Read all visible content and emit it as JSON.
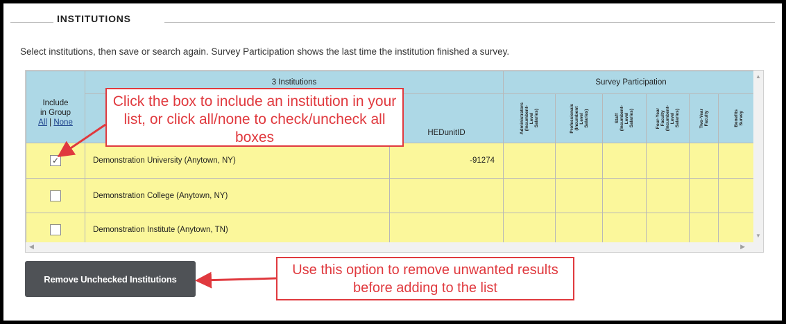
{
  "section": {
    "title": "INSTITUTIONS",
    "intro": "Select institutions, then save or search again. Survey Participation shows the last time the institution finished a survey."
  },
  "table": {
    "group_header": "3 Institutions",
    "survey_header": "Survey Participation",
    "include_label_line1": "Include",
    "include_label_line2": "in Group",
    "all_link": "All",
    "separator": "|",
    "none_link": "None",
    "hed_header": "HEDunitID",
    "survey_columns": [
      "Administrators\n(Incumbent-\nLevel\nSalaries)",
      "Professionals\n(Incumbent\nLevel\nSalaries)",
      "Staff\n(Incumbent-\nLevel\nSalaries)",
      "Four-Year\nFaculty\n(Incumbent-\nLevel\nSalaries)",
      "Two-Year\nFaculty",
      "Benefits\nSurvey"
    ],
    "rows": [
      {
        "checked": true,
        "check_mark": "✓",
        "name": "Demonstration University (Anytown, NY)",
        "hedunitid": "-91274"
      },
      {
        "checked": false,
        "check_mark": "",
        "name": "Demonstration College (Anytown, NY)",
        "hedunitid": ""
      },
      {
        "checked": false,
        "check_mark": "",
        "name": "Demonstration Institute (Anytown, TN)",
        "hedunitid": ""
      }
    ]
  },
  "button": {
    "label": "Remove Unchecked Institutions"
  },
  "callouts": {
    "include_tip": "Click the box to include an institution in your list, or click all/none to check/uncheck all boxes",
    "remove_tip": "Use this option to remove unwanted results before adding to the list"
  },
  "colors": {
    "header_bg": "#add8e6",
    "row_bg": "#fbf79b",
    "callout": "#e0393e",
    "button_bg": "#4f5256"
  },
  "icons": {
    "checkbox": "checkbox-icon",
    "arrow": "arrow-icon",
    "scroll_up": "scroll-up-icon",
    "scroll_down": "scroll-down-icon",
    "scroll_left": "scroll-left-icon",
    "scroll_right": "scroll-right-icon"
  }
}
